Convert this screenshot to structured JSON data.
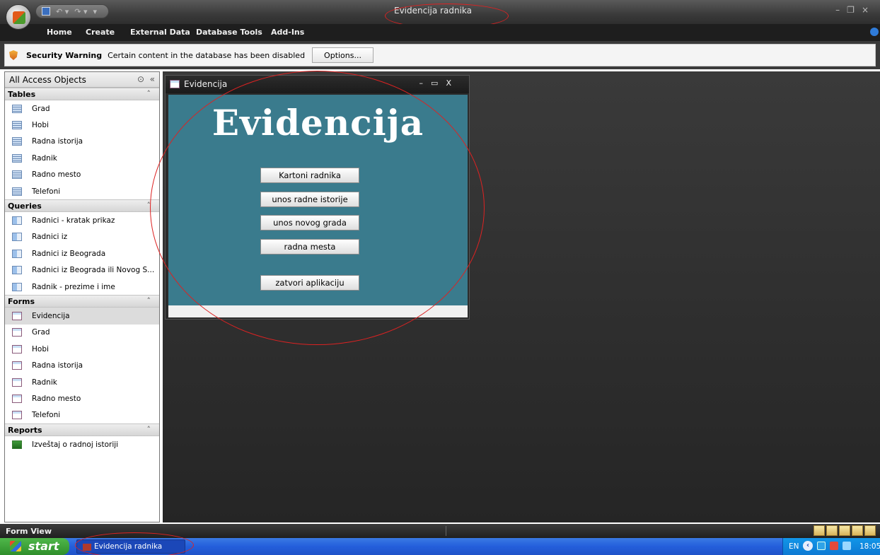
{
  "app": {
    "window_title": "Evidencija radnika"
  },
  "ribbon": {
    "tabs": [
      "Home",
      "Create",
      "External Data",
      "Database Tools",
      "Add-Ins"
    ]
  },
  "security_bar": {
    "title": "Security Warning",
    "message": "Certain content in the database has been disabled",
    "options_label": "Options..."
  },
  "nav": {
    "header": "All Access Objects",
    "groups": [
      {
        "name": "Tables",
        "icon": "table-icon",
        "items": [
          "Grad",
          "Hobi",
          "Radna istorija",
          "Radnik",
          "Radno mesto",
          "Telefoni"
        ]
      },
      {
        "name": "Queries",
        "icon": "query-icon",
        "items": [
          "Radnici - kratak prikaz",
          "Radnici iz",
          "Radnici iz Beograda",
          "Radnici iz Beograda ili Novog S...",
          "Radnik - prezime i ime"
        ]
      },
      {
        "name": "Forms",
        "icon": "form-icon",
        "items": [
          "Evidencija",
          "Grad",
          "Hobi",
          "Radna istorija",
          "Radnik",
          "Radno mesto",
          "Telefoni"
        ],
        "selected": "Evidencija"
      },
      {
        "name": "Reports",
        "icon": "report-icon",
        "items": [
          "Izveštaj o radnoj istoriji"
        ]
      }
    ]
  },
  "form": {
    "window_title": "Evidencija",
    "heading": "Evidencija",
    "buttons": [
      "Kartoni radnika",
      "unos radne istorije",
      "unos novog grada",
      "radna mesta",
      "zatvori aplikaciju"
    ]
  },
  "statusbar": {
    "text": "Form View"
  },
  "taskbar": {
    "start_label": "start",
    "task_item": "Evidencija radnika",
    "language": "EN",
    "clock": "18:05"
  },
  "colors": {
    "form_background": "#3a7b8d",
    "annotation_ring": "#dd2222",
    "taskbar": "#245edb"
  }
}
